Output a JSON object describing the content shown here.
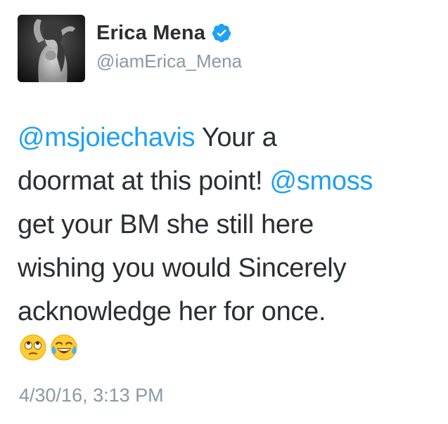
{
  "author": {
    "display_name": "Erica Mena",
    "handle": "@iamErica_Mena",
    "verified": true,
    "verified_color": "#1da1f2",
    "avatar_icon": "profile-photo"
  },
  "tweet": {
    "lines": [
      [
        {
          "text": "@msjoiechavis",
          "mention": true
        },
        {
          "text": " Your a",
          "mention": false
        }
      ],
      [
        {
          "text": "doormat at this point! ",
          "mention": false
        },
        {
          "text": "@smoss",
          "mention": true
        }
      ],
      [
        {
          "text": "get your BM she still here",
          "mention": false
        }
      ],
      [
        {
          "text": "wishing you would Sincerely",
          "mention": false
        }
      ],
      [
        {
          "text": "acknowledge her for once.",
          "mention": false
        }
      ]
    ],
    "emojis": [
      "eye-roll-emoji",
      "tears-of-joy-emoji"
    ],
    "timestamp": "4/30/16, 3:13 PM"
  },
  "colors": {
    "text": "#292f33",
    "mention": "#1da1f2",
    "secondary": "#8899a6"
  }
}
